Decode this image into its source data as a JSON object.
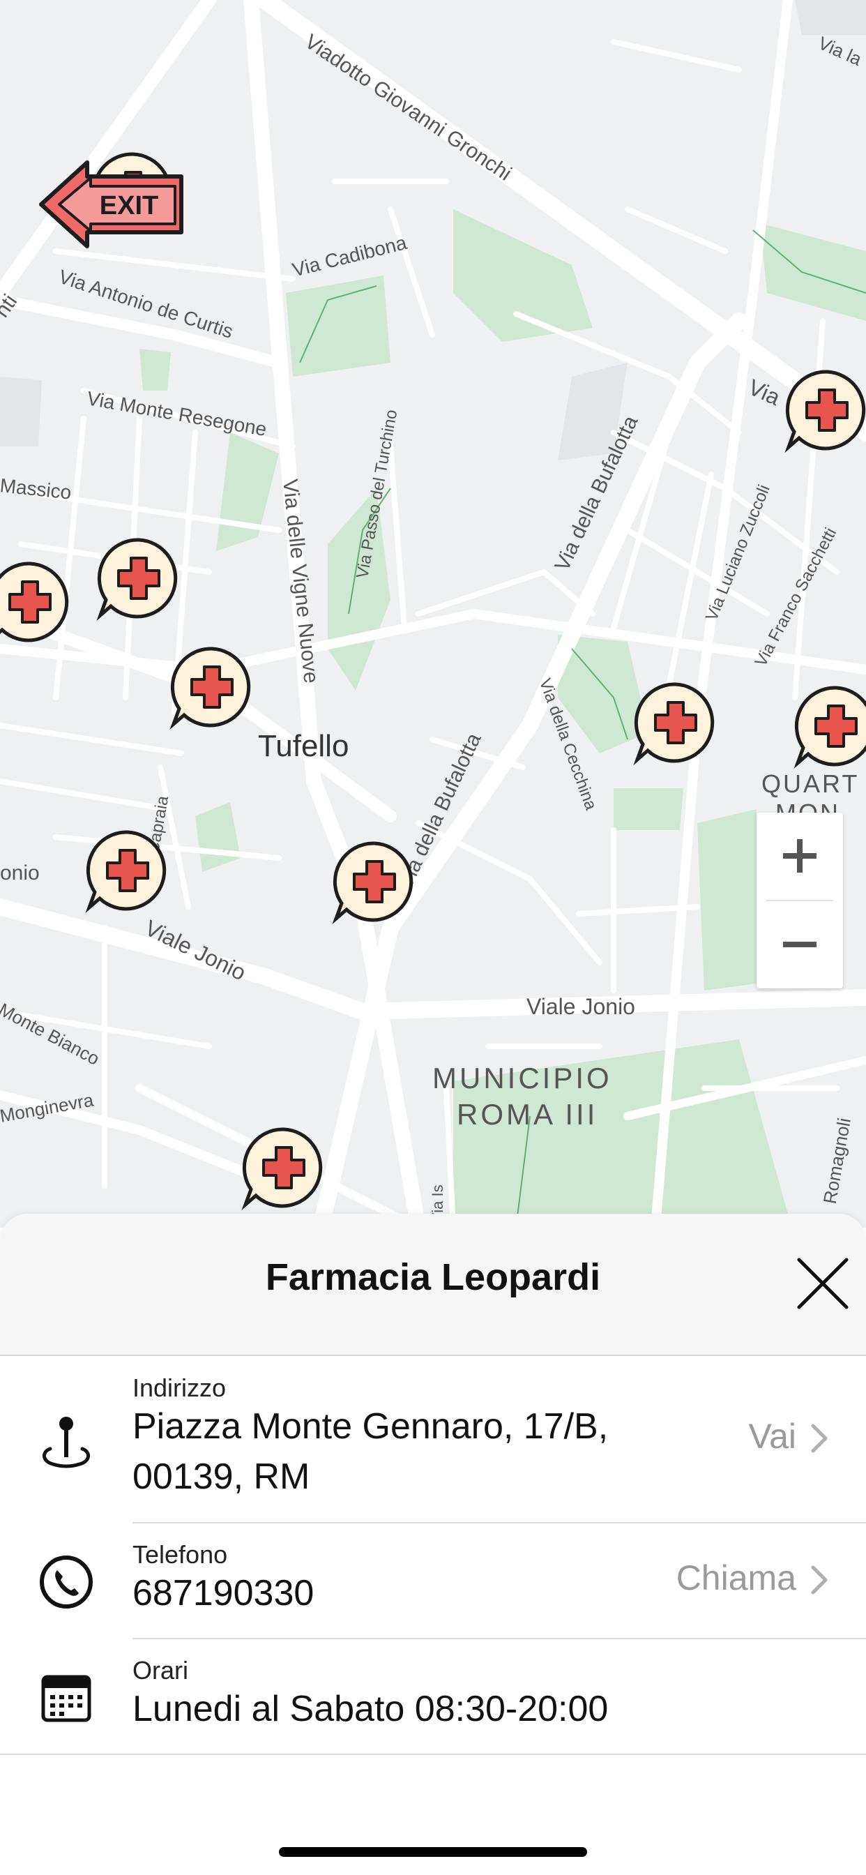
{
  "map": {
    "labels": {
      "viadotto_giovanni_gronchi": "Viadotto Giovanni Gronchi",
      "via_cadibona": "Via Cadibona",
      "via_antonio_de_curtis": "Via Antonio de Curtis",
      "via_monte_resegone": "Via Monte Resegone",
      "massico": "Massico",
      "via_passo_del_turchino": "Via Passo del Turchino",
      "via_delle_vigne_nuove": "Via delle Vigne Nuove",
      "via_della_bufalotta_1": "Via della Bufalotta",
      "via_della_bufalotta_2": "Via della Bufalotta",
      "via_luciano_zuccoli": "Via Luciano Zuccoli",
      "via_franco_sacchetti": "Via Franco Sacchetti",
      "via_della_cecchina": "Via della Cecchina",
      "tufello": "Tufello",
      "capraia": "Capraia",
      "onio": "onio",
      "viale_jonio_1": "Viale Jonio",
      "viale_jonio_2": "Viale Jonio",
      "monte_bianco": "Monte Bianco",
      "monginevra": "Monginevra",
      "municipio": "MUNICIPIO",
      "roma_iii": "ROMA III",
      "quart": "QUART",
      "mon": "MON",
      "romagnoli": "Romagnoli",
      "via_la": "Via la",
      "via_v": "Via",
      "nti": "nti",
      "via_is": "Via Is"
    },
    "pharmacy_icon": "pharmacy-cross-marker-icon",
    "exit_label": "EXIT",
    "zoom_in_icon": "plus-icon",
    "zoom_out_icon": "minus-icon"
  },
  "sheet": {
    "title": "Farmacia Leopardi",
    "close_icon": "close-icon",
    "address": {
      "icon": "location-pin-icon",
      "label": "Indirizzo",
      "line1": "Piazza Monte Gennaro, 17/B,",
      "line2": "00139, RM",
      "action": "Vai"
    },
    "phone": {
      "icon": "phone-icon",
      "label": "Telefono",
      "value": "687190330",
      "action": "Chiama"
    },
    "hours": {
      "icon": "calendar-icon",
      "label": "Orari",
      "value": "Lunedi al Sabato 08:30-20:00"
    }
  },
  "colors": {
    "map_bg": "#eef0f2",
    "road": "#ffffff",
    "park": "#cde8d1",
    "marker_fill": "#fdf3dc",
    "cross": "#e8554e"
  }
}
